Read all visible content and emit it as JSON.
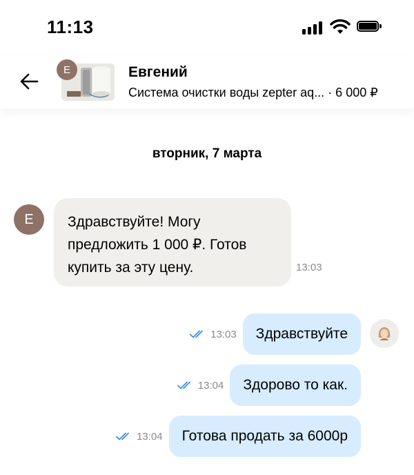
{
  "status_bar": {
    "time": "11:13"
  },
  "header": {
    "contact_name": "Евгений",
    "avatar_initial": "Е",
    "item_title": "Система очистки воды zepter aq...",
    "item_price": " · 6 000 ₽"
  },
  "chat": {
    "date": "вторник, 7 марта",
    "messages": [
      {
        "direction": "in",
        "sender_initial": "Е",
        "text": "Здравствуйте! Могу предложить 1 000 ₽. Готов купить за эту цену.",
        "time": "13:03"
      },
      {
        "direction": "out",
        "text": "Здравствуйте",
        "time": "13:03",
        "status": "read"
      },
      {
        "direction": "out",
        "text": "Здорово то как.",
        "time": "13:04",
        "status": "read"
      },
      {
        "direction": "out",
        "text": "Готова продать за 6000р",
        "time": "13:04",
        "status": "read"
      }
    ]
  },
  "colors": {
    "incoming_bubble": "#f1efeb",
    "outgoing_bubble": "#d7ecff",
    "read_check": "#3a8ee6",
    "avatar": "#8e7266"
  }
}
